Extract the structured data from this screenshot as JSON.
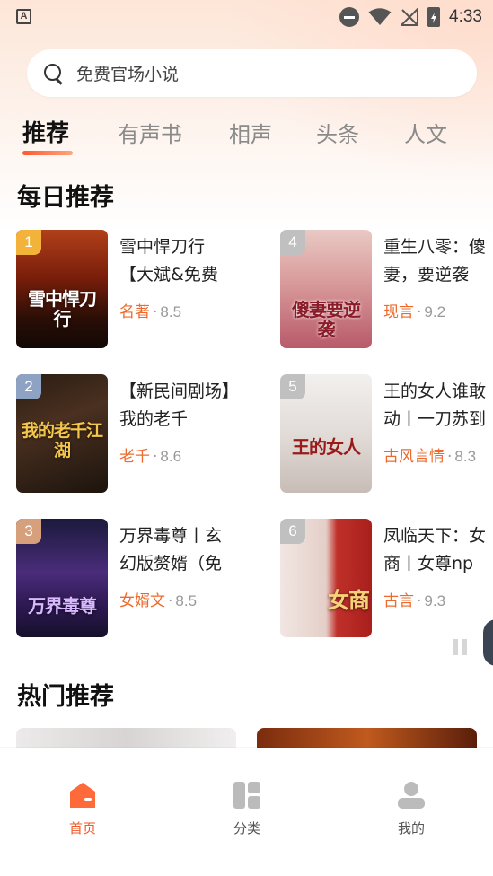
{
  "status_bar": {
    "time": "4:33",
    "app_badge": "A"
  },
  "search": {
    "placeholder": "免费官场小说"
  },
  "tabs": [
    {
      "label": "推荐",
      "active": true
    },
    {
      "label": "有声书",
      "active": false
    },
    {
      "label": "相声",
      "active": false
    },
    {
      "label": "头条",
      "active": false
    },
    {
      "label": "人文",
      "active": false
    }
  ],
  "daily": {
    "title": "每日推荐",
    "books": [
      {
        "rank": "1",
        "title": "雪中悍刀行【大斌&免费",
        "category": "名著",
        "score": "8.5",
        "cover_text": "雪中悍刀行",
        "rank_color": "#f3b33a"
      },
      {
        "rank": "2",
        "title": "【新民间剧场】我的老千",
        "category": "老千",
        "score": "8.6",
        "cover_text": "我的老千江湖",
        "rank_color": "#8ea3c4"
      },
      {
        "rank": "3",
        "title": "万界毒尊丨玄幻版赘婿（免",
        "category": "女婿文",
        "score": "8.5",
        "cover_text": "万界毒尊",
        "rank_color": "#d7a07c"
      },
      {
        "rank": "4",
        "title": "重生八零：傻妻，要逆袭",
        "category": "现言",
        "score": "9.2",
        "cover_text": "傻妻要逆袭",
        "rank_color": "#c0c0c0"
      },
      {
        "rank": "5",
        "title": "王的女人谁敢动丨一刀苏到底",
        "category": "古风言情",
        "score": "8.3",
        "cover_text": "王的女人",
        "rank_color": "#c0c0c0"
      },
      {
        "rank": "6",
        "title": "凤临天下：女商丨女尊np",
        "category": "古言",
        "score": "9.3",
        "cover_text": "女商",
        "rank_color": "#c0c0c0"
      }
    ]
  },
  "hot": {
    "title": "热门推荐"
  },
  "bottom_nav": [
    {
      "label": "首页",
      "icon": "home-icon",
      "active": true
    },
    {
      "label": "分类",
      "icon": "category-icon",
      "active": false
    },
    {
      "label": "我的",
      "icon": "profile-icon",
      "active": false
    }
  ],
  "colors": {
    "accent": "#ee6a2c",
    "active_tab_underline": "#ff5a2e"
  }
}
